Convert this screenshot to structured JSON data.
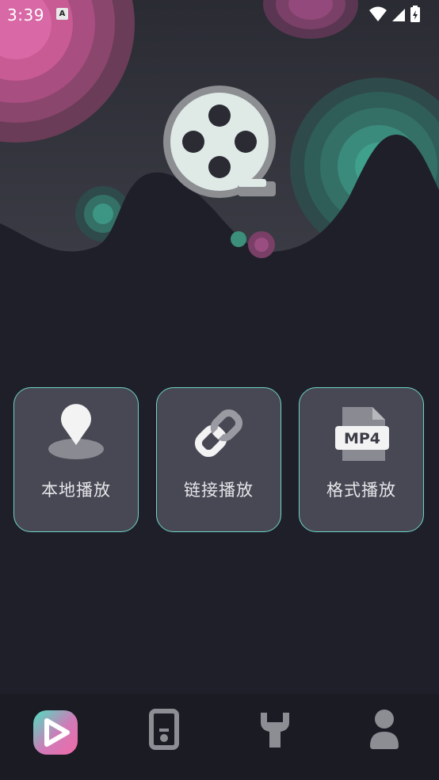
{
  "status_bar": {
    "time": "3:39",
    "notification_icon": "A",
    "icons": [
      "wifi-icon",
      "cell-signal-icon",
      "battery-charging-icon"
    ]
  },
  "hero": {
    "logo_icon": "film-reel-icon"
  },
  "cards": [
    {
      "label": "本地播放",
      "icon": "location-pin-icon"
    },
    {
      "label": "链接播放",
      "icon": "link-icon"
    },
    {
      "label": "格式播放",
      "icon": "mp4-file-icon",
      "icon_text": "MP4"
    }
  ],
  "bottom_nav": {
    "items": [
      {
        "icon": "play-app-icon",
        "active": true
      },
      {
        "icon": "device-icon",
        "active": false
      },
      {
        "icon": "wrench-icon",
        "active": false
      },
      {
        "icon": "profile-icon",
        "active": false
      }
    ]
  },
  "colors": {
    "background": "#1e1f29",
    "card_background": "#474853",
    "card_border": "#6fd3c6",
    "accent_pink": "#e06aa6",
    "accent_teal": "#3fbfa5"
  }
}
